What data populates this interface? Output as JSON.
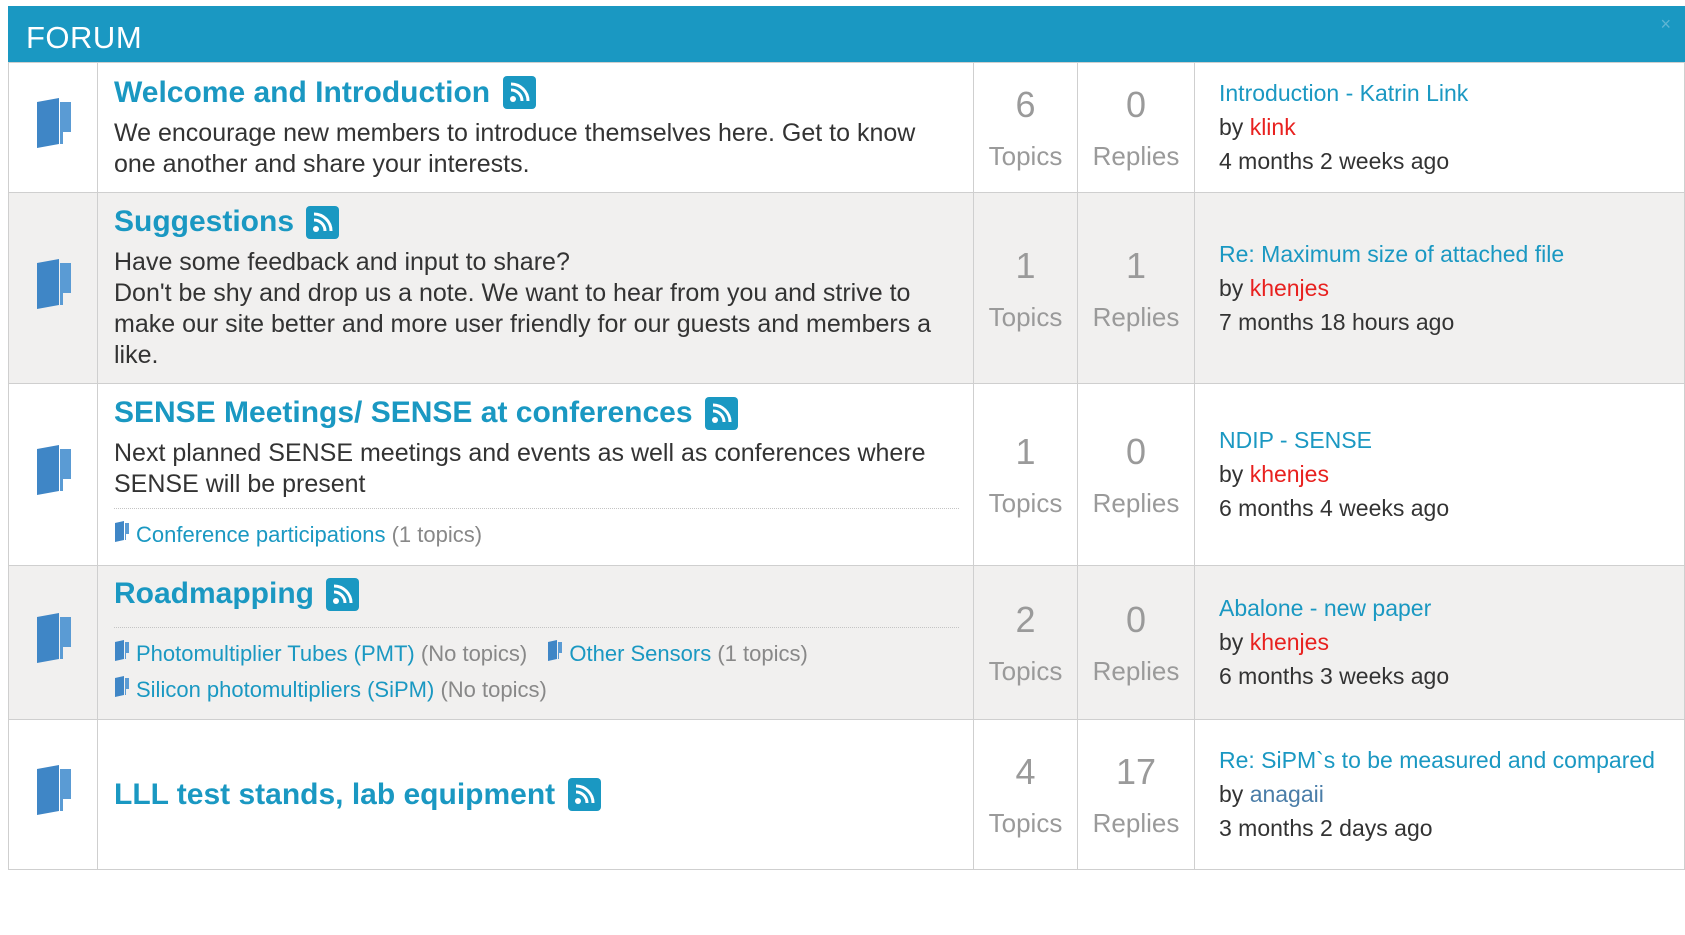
{
  "header": {
    "title": "FORUM",
    "close": "×"
  },
  "categories": [
    {
      "title": "Welcome and Introduction",
      "description": "We encourage new members to introduce themselves here. Get to know one another and share your interests.",
      "topics": "6",
      "topics_label": "Topics",
      "replies": "0",
      "replies_label": "Replies",
      "last_topic": "Introduction - Katrin Link",
      "by": "by",
      "author": "klink",
      "time": "4 months 2 weeks ago"
    },
    {
      "title": "Suggestions",
      "description_lines": [
        "Have some feedback and input to share?",
        "Don't be shy and drop us a note. We want to hear from you and strive to make our site better and more user friendly for our guests and members a like."
      ],
      "topics": "1",
      "topics_label": "Topics",
      "replies": "1",
      "replies_label": "Replies",
      "last_topic": "Re: Maximum size of attached file",
      "by": "by",
      "author": "khenjes",
      "time": "7 months 18 hours ago"
    },
    {
      "title": "SENSE Meetings/ SENSE at conferences",
      "description": "Next planned SENSE meetings and events as well as conferences where SENSE will be present",
      "subcategories": [
        {
          "name": "Conference participations",
          "count": "(1 topics)"
        }
      ],
      "topics": "1",
      "topics_label": "Topics",
      "replies": "0",
      "replies_label": "Replies",
      "last_topic": "NDIP - SENSE",
      "by": "by",
      "author": "khenjes",
      "time": "6 months 4 weeks ago"
    },
    {
      "title": "Roadmapping",
      "subcategories": [
        {
          "name": "Photomultiplier Tubes (PMT)",
          "count": "(No topics)"
        },
        {
          "name": "Other Sensors",
          "count": "(1 topics)"
        },
        {
          "name": "Silicon photomultipliers (SiPM)",
          "count": "(No topics)"
        }
      ],
      "topics": "2",
      "topics_label": "Topics",
      "replies": "0",
      "replies_label": "Replies",
      "last_topic": "Abalone - new paper",
      "by": "by",
      "author": "khenjes",
      "time": "6 months 3 weeks ago"
    },
    {
      "title": "LLL test stands, lab equipment",
      "topics": "4",
      "topics_label": "Topics",
      "replies": "17",
      "replies_label": "Replies",
      "last_topic": "Re: SiPM`s to be measured and compared",
      "by": "by",
      "author": "anagaii",
      "time": "3 months 2 days ago"
    }
  ],
  "colors": {
    "accent": "#1a98c2",
    "author": "#e8211f",
    "alt_row": "#f1f0ef"
  }
}
